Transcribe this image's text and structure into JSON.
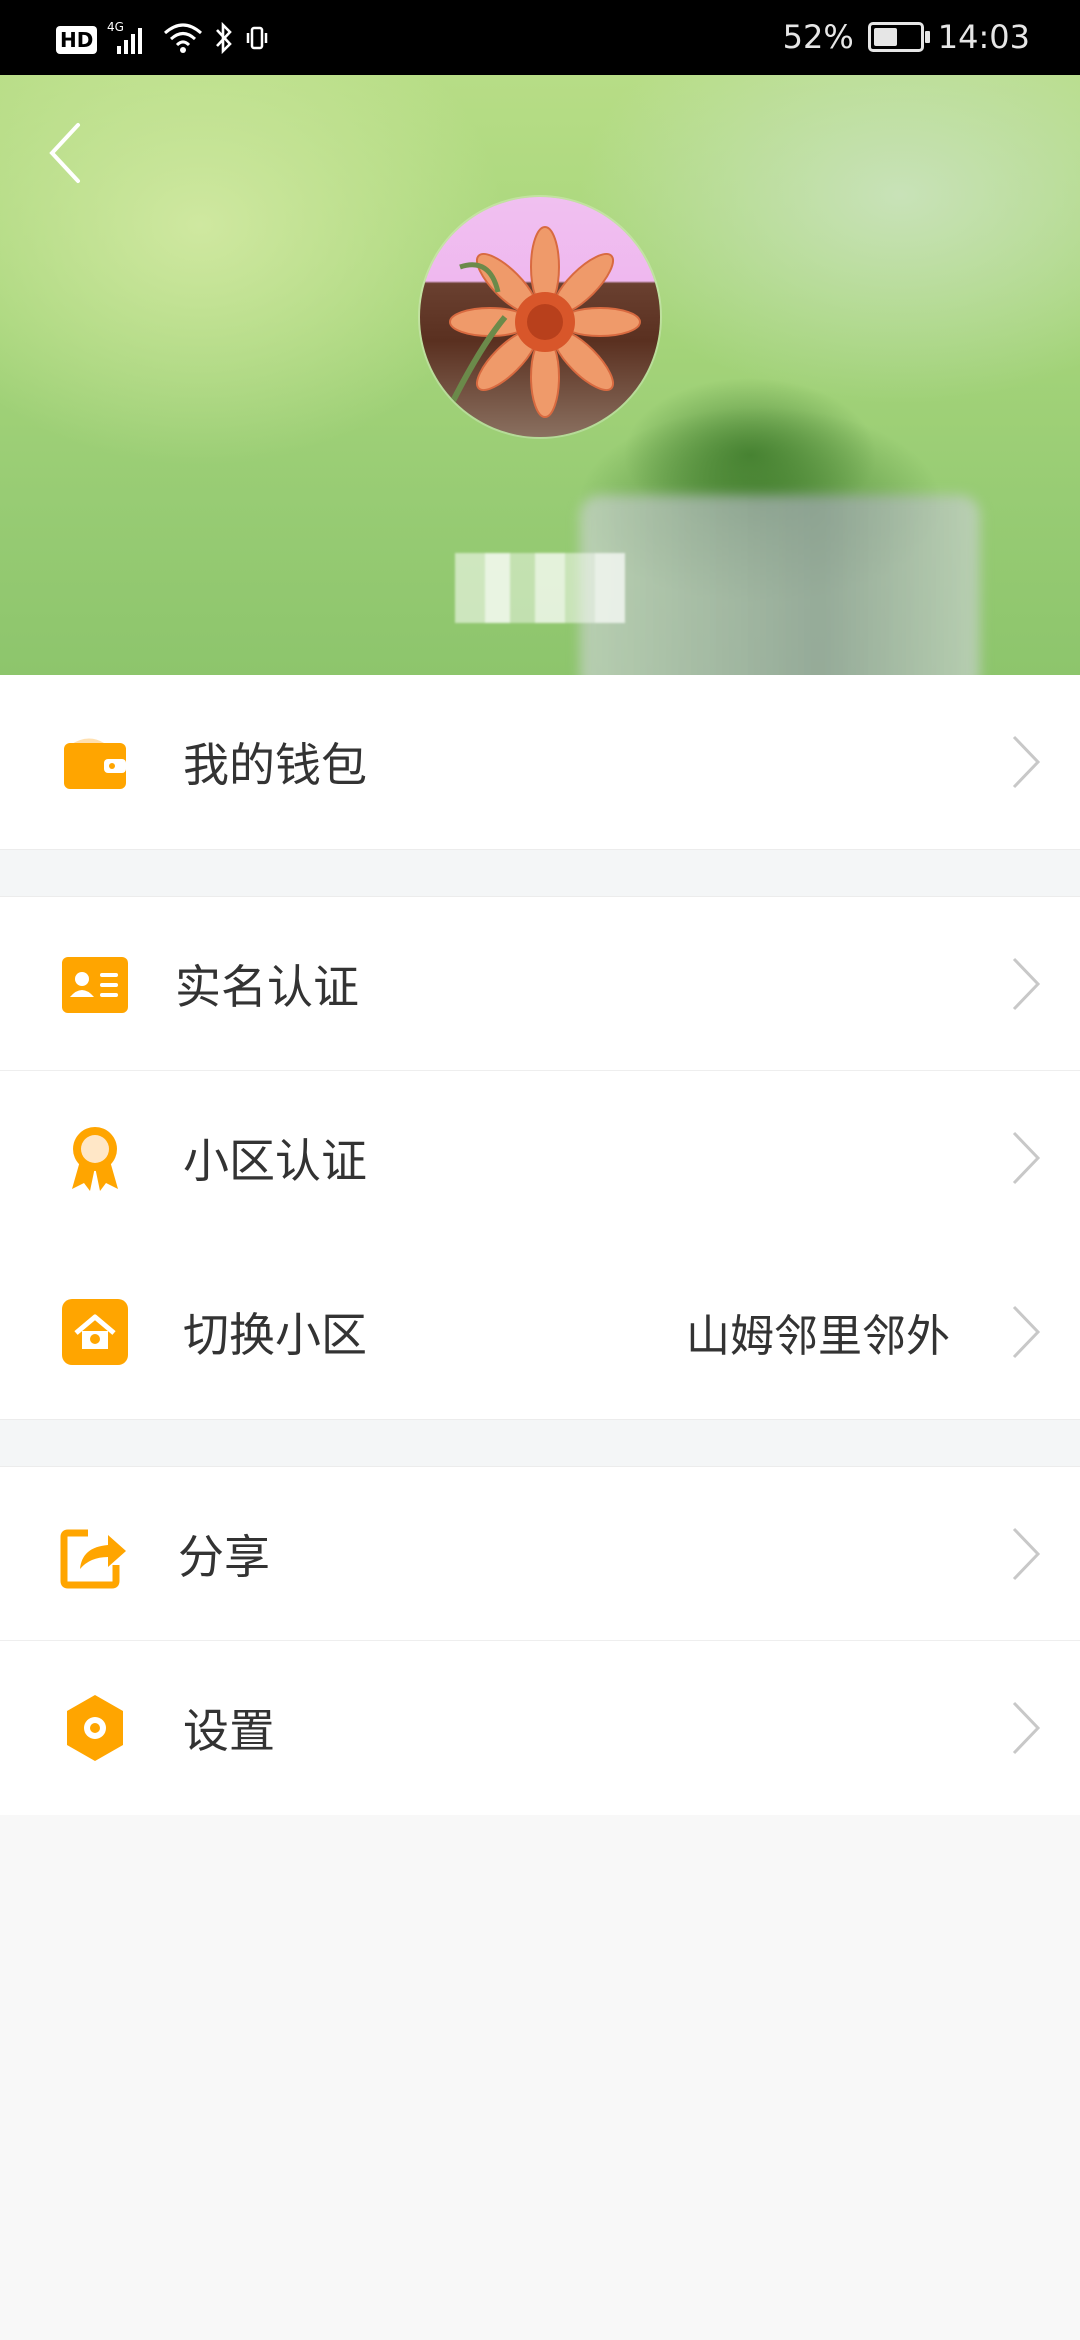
{
  "status_bar": {
    "hd": "HD",
    "network": "4G",
    "battery_percent": "52%",
    "time": "14:03",
    "battery_level": 0.52
  },
  "profile": {
    "avatar_icon": "flower-avatar",
    "username": ""
  },
  "menu": {
    "wallet": {
      "label": "我的钱包",
      "icon": "wallet-icon"
    },
    "realname": {
      "label": "实名认证",
      "icon": "id-card-icon"
    },
    "community_auth": {
      "label": "小区认证",
      "icon": "award-ribbon-icon"
    },
    "switch_community": {
      "label": "切换小区",
      "value": "山姆邻里邻外",
      "icon": "home-icon"
    },
    "share": {
      "label": "分享",
      "icon": "share-icon"
    },
    "settings": {
      "label": "设置",
      "icon": "settings-hexagon-icon"
    }
  },
  "colors": {
    "accent": "#FFA500",
    "chevron": "#c8c8c8",
    "page_bg": "#f8f8f8",
    "separator_bg": "#f4f6f7"
  }
}
